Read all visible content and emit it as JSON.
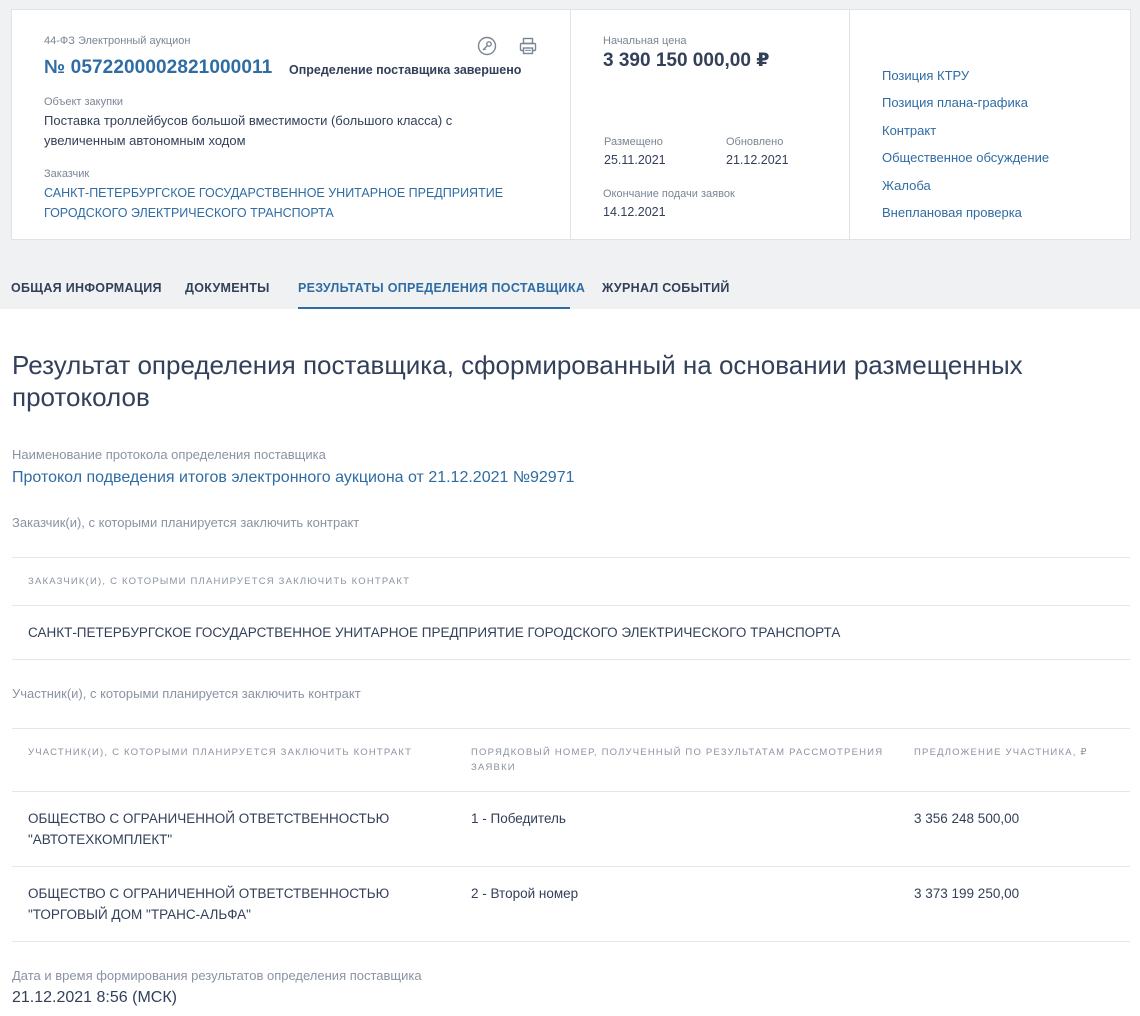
{
  "header": {
    "procurement_type": "44-ФЗ Электронный аукцион",
    "reg_number": "№ 0572200002821000011",
    "status": "Определение поставщика завершено",
    "object_label": "Объект закупки",
    "object_value": "Поставка троллейбусов большой вместимости (большого класса) с увеличенным автономным ходом",
    "customer_label": "Заказчик",
    "customer_value": "САНКТ-ПЕТЕРБУРГСКОЕ ГОСУДАРСТВЕННОЕ УНИТАРНОЕ ПРЕДПРИЯТИЕ ГОРОДСКОГО ЭЛЕКТРИЧЕСКОГО ТРАНСПОРТА",
    "icons": [
      "key-icon",
      "print-icon"
    ]
  },
  "price_block": {
    "price_label": "Начальная цена",
    "price_value": "3 390 150 000,00 ₽",
    "placed_label": "Размещено",
    "placed_value": "25.11.2021",
    "updated_label": "Обновлено",
    "updated_value": "21.12.2021",
    "deadline_label": "Окончание подачи заявок",
    "deadline_value": "14.12.2021"
  },
  "side_links": [
    "Позиция КТРУ",
    "Позиция плана-графика",
    "Контракт",
    "Общественное обсуждение",
    "Жалоба",
    "Внеплановая проверка"
  ],
  "tabs": [
    {
      "label": "ОБЩАЯ ИНФОРМАЦИЯ",
      "active": false
    },
    {
      "label": "ДОКУМЕНТЫ",
      "active": false
    },
    {
      "label": "РЕЗУЛЬТАТЫ ОПРЕДЕЛЕНИЯ ПОСТАВЩИКА",
      "active": true
    },
    {
      "label": "ЖУРНАЛ СОБЫТИЙ",
      "active": false
    }
  ],
  "main": {
    "title": "Результат определения поставщика, сформированный на основании размещенных протоколов",
    "protocol_label": "Наименование протокола определения поставщика",
    "protocol_link": "Протокол подведения итогов электронного аукциона от 21.12.2021 №92971",
    "customers_section_label": "Заказчик(и), с которыми планируется заключить контракт",
    "customers_table": {
      "header": "Заказчик(и), с которыми планируется заключить контракт",
      "rows": [
        "САНКТ-ПЕТЕРБУРГСКОЕ ГОСУДАРСТВЕННОЕ УНИТАРНОЕ ПРЕДПРИЯТИЕ ГОРОДСКОГО ЭЛЕКТРИЧЕСКОГО ТРАНСПОРТА"
      ]
    },
    "participants_section_label": "Участник(и), с которыми планируется заключить контракт",
    "participants_table": {
      "headers": [
        "Участник(и), с которыми планируется заключить контракт",
        "Порядковый номер, полученный по результатам рассмотрения заявки",
        "Предложение участника, ₽"
      ],
      "rows": [
        {
          "name": "ОБЩЕСТВО С ОГРАНИЧЕННОЙ ОТВЕТСТВЕННОСТЬЮ \"АВТОТЕХКОМПЛЕКТ\"",
          "rank": "1 - Победитель",
          "offer": "3 356 248 500,00"
        },
        {
          "name": "ОБЩЕСТВО С ОГРАНИЧЕННОЙ ОТВЕТСТВЕННОСТЬЮ \"ТОРГОВЫЙ ДОМ \"ТРАНС-АЛЬФА\"",
          "rank": "2 - Второй номер",
          "offer": "3 373 199 250,00"
        }
      ]
    },
    "datetime_label": "Дата и время формирования результатов определения поставщика",
    "datetime_value": "21.12.2021 8:56 (МСК)"
  },
  "colors": {
    "accent": "#2f6ca3",
    "text": "#334059",
    "muted": "#7b8595",
    "background_top": "#eff1f3"
  }
}
